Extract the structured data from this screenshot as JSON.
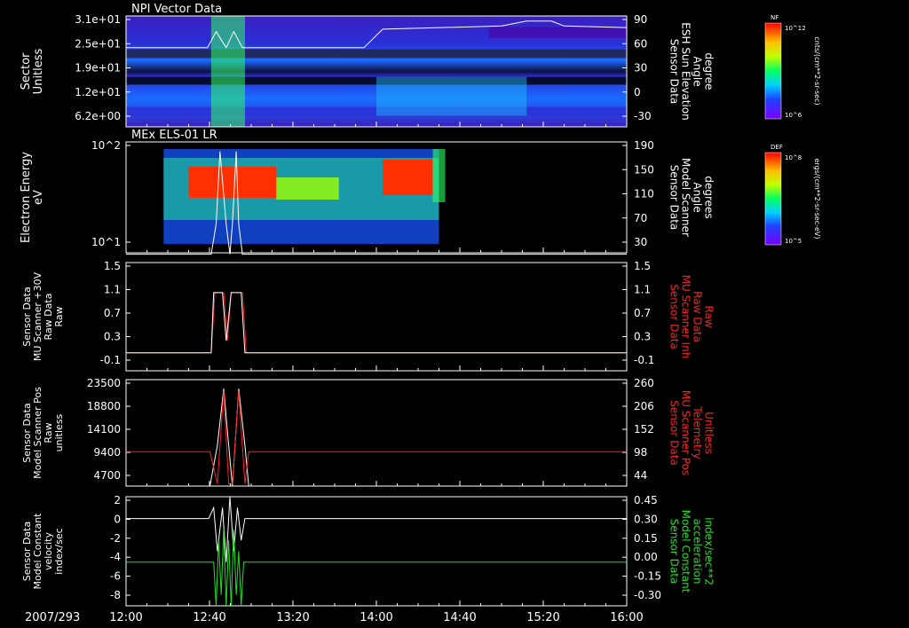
{
  "footer": {
    "date": "2007/293"
  },
  "time_axis": {
    "ticks": [
      "12:00",
      "12:40",
      "13:20",
      "14:00",
      "14:40",
      "15:20",
      "16:00"
    ]
  },
  "colors": {
    "white": "#ffffff",
    "red": "#ff2020",
    "green": "#20e020"
  },
  "colorbars": [
    {
      "tag": "NF",
      "units": "cnts/(cm**2-sr-sec)",
      "max": "10^12",
      "min": "10^6"
    },
    {
      "tag": "DEF",
      "units": "ergs/(cm**2-sr-sec-eV)",
      "max": "10^8",
      "min": "10^5"
    }
  ],
  "chart_data": [
    {
      "type": "heatmap",
      "title": "NPI Vector Data",
      "left_label": [
        "Sector",
        "Unitless"
      ],
      "right_label": [
        "Sensor Data",
        "ESH Sun Elevation",
        "Angle",
        "degree"
      ],
      "left_ticks": [
        "3.1e+01",
        "2.5e+01",
        "1.9e+01",
        "1.2e+01",
        "6.2e+00"
      ],
      "right_ticks": [
        "90",
        "60",
        "30",
        "0",
        "-30"
      ],
      "overlay_line": [
        [
          12.0,
          55
        ],
        [
          12.65,
          55
        ],
        [
          12.72,
          75
        ],
        [
          12.8,
          55
        ],
        [
          12.86,
          75
        ],
        [
          12.93,
          55
        ],
        [
          13.9,
          55
        ],
        [
          14.05,
          78
        ],
        [
          15.0,
          82
        ],
        [
          15.2,
          88
        ],
        [
          15.4,
          88
        ],
        [
          15.5,
          82
        ],
        [
          16.0,
          80
        ]
      ]
    },
    {
      "type": "heatmap",
      "title": "MEx ELS-01 LR",
      "left_label": [
        "Electron Energy",
        "eV"
      ],
      "left_ticks": [
        "10^2",
        "10^1"
      ],
      "right_label": [
        "Sensor Data",
        "Model Scanner",
        "Angle",
        "degrees"
      ],
      "right_ticks": [
        "190",
        "150",
        "110",
        "70",
        "30"
      ],
      "overlay_line": [
        [
          12.0,
          10
        ],
        [
          12.68,
          10
        ],
        [
          12.72,
          60
        ],
        [
          12.75,
          180
        ],
        [
          12.8,
          60
        ],
        [
          12.83,
          10
        ],
        [
          12.85,
          60
        ],
        [
          12.88,
          180
        ],
        [
          12.9,
          60
        ],
        [
          12.93,
          10
        ],
        [
          16.0,
          10
        ]
      ]
    },
    {
      "type": "line",
      "left_label": [
        "Sensor Data",
        "MU Scanner +30V",
        "Raw Data",
        "Raw"
      ],
      "left_ticks": [
        "1.5",
        "1.1",
        "0.7",
        "0.3",
        "-0.1"
      ],
      "right_label": [
        "Sensor Data",
        "MU Scanner Inh",
        "Raw Data",
        "Raw"
      ],
      "right_ticks": [
        "1.5",
        "1.1",
        "0.7",
        "0.3",
        "-0.1"
      ],
      "ylim": [
        -0.3,
        1.5
      ],
      "series": [
        {
          "color": "red",
          "x": [
            12.0,
            12.68,
            12.71,
            12.78,
            12.81,
            12.84,
            12.87,
            12.93,
            12.96,
            16.0
          ],
          "y": [
            0,
            0,
            1,
            1,
            0.2,
            1,
            1,
            1,
            0,
            0
          ]
        },
        {
          "color": "white",
          "x": [
            12.0,
            12.68,
            12.7,
            12.77,
            12.8,
            12.84,
            12.86,
            12.92,
            12.95,
            16.0
          ],
          "y": [
            0,
            0,
            1,
            1,
            0.2,
            1,
            1,
            1,
            0,
            0
          ]
        }
      ]
    },
    {
      "type": "line",
      "left_label": [
        "Sensor Data",
        "Model Scanner Pos",
        "Raw",
        "unitless"
      ],
      "left_ticks": [
        "23500",
        "18800",
        "14100",
        "9400",
        "4700"
      ],
      "right_label": [
        "Sensor Data",
        "MU Scanner Pos",
        "Telemetry",
        "Unitless"
      ],
      "right_ticks": [
        "260",
        "206",
        "152",
        "98",
        "44"
      ],
      "ylim": [
        0,
        23500
      ],
      "series": [
        {
          "color": "white",
          "x": [
            12.0,
            12.67,
            12.73,
            12.78,
            12.82,
            12.85,
            12.9,
            12.95,
            12.98,
            16.0
          ],
          "y": [
            0,
            0,
            9000,
            21500,
            9000,
            0,
            21500,
            9000,
            0,
            0
          ]
        },
        {
          "color": "red",
          "x": [
            12.0,
            12.67,
            12.73,
            12.78,
            12.82,
            12.85,
            12.9,
            12.95,
            12.98,
            16.0
          ],
          "y": [
            7600,
            7600,
            500,
            21000,
            500,
            500,
            21000,
            500,
            7600,
            7600
          ]
        }
      ]
    },
    {
      "type": "line",
      "left_label": [
        "Sensor Data",
        "Model Constant",
        "velocity",
        "index/sec"
      ],
      "left_ticks": [
        "2",
        "0",
        "-2",
        "-4",
        "-6",
        "-8"
      ],
      "right_label": [
        "Sensor Data",
        "Model Constant",
        "acceleration",
        "index/sec**2"
      ],
      "right_ticks": [
        "0.45",
        "0.30",
        "0.15",
        "0.00",
        "-0.15",
        "-0.30"
      ],
      "ylim": [
        -8,
        2
      ],
      "series": [
        {
          "color": "white",
          "x": [
            12.0,
            12.66,
            12.7,
            12.73,
            12.77,
            12.8,
            12.83,
            12.86,
            12.89,
            12.92,
            12.95,
            16.0
          ],
          "y": [
            0,
            0,
            1,
            -3,
            1,
            -4,
            2,
            -3,
            1,
            -2,
            0,
            0
          ]
        },
        {
          "color": "green",
          "x": [
            12.0,
            12.7,
            12.72,
            12.74,
            12.76,
            12.78,
            12.8,
            12.82,
            12.84,
            12.86,
            12.88,
            12.9,
            12.92,
            12.94,
            16.0
          ],
          "y": [
            -4,
            -4,
            -8,
            -2,
            -7,
            -1,
            -8,
            -2,
            -8,
            -1,
            -7,
            -3,
            -8,
            -4,
            -4
          ]
        }
      ]
    }
  ]
}
